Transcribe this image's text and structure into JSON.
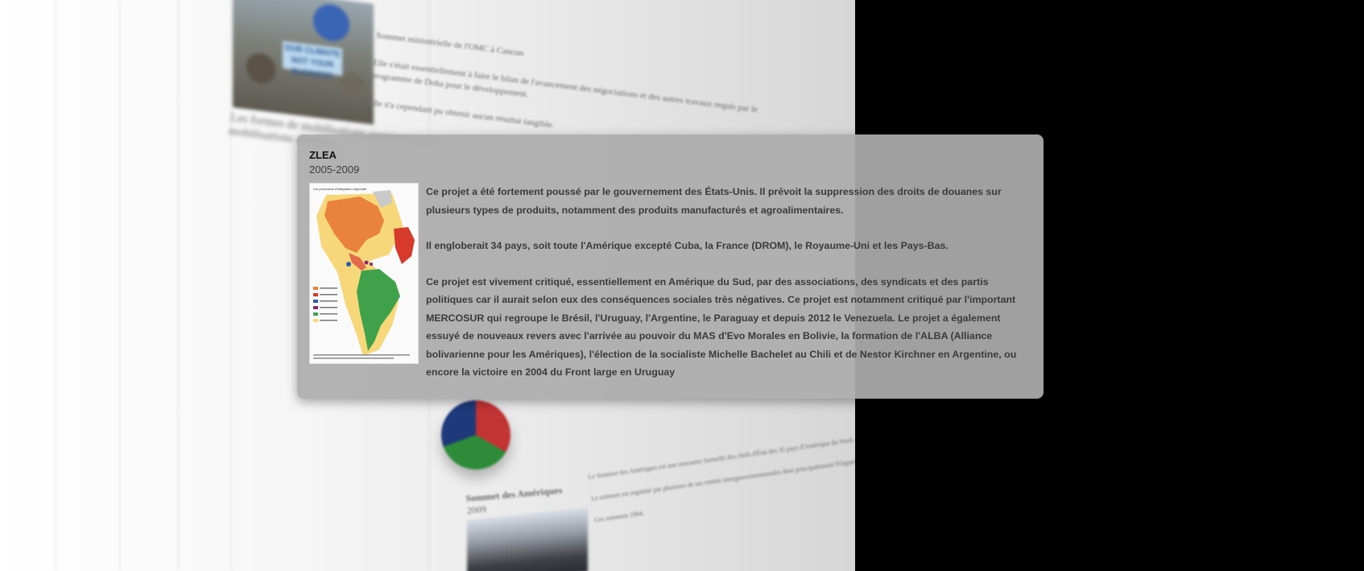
{
  "backdrop": {
    "photo_sign": [
      "OUR CLIMATE",
      "NOT YOUR BUSINESS"
    ],
    "card_top_lines": [
      "Sommet ministérielle de l'OMC à Cancun",
      "Elle s'était essentiellement à faire le bilan de l'avancement des négociations et des autres travaux requis par le",
      "programme de Doha pour le développement.",
      "Elle n'a cependant pu obtenir aucun résultat tangible."
    ],
    "mobilisation_line": "Les formes de mobilisations prennent les le",
    "mobilisation_line_2": "mobilisations diverses",
    "sommet_title": "Sommet des Amériques",
    "sommet_year": "2009",
    "sommet_lines": [
      "Le Sommet des Amériques est une rencontre formelle des chefs d'État des 35 pays d'Amérique du Nord, Amérique centrale et d'Amérique du Sud.",
      "Le sommet est organisé par plusieurs de ses entités intergouvernementales dont principalement l'Organisation des États américains",
      "Ces sommets 1994."
    ]
  },
  "popup": {
    "title": "ZLEA",
    "dates": "2005-2009",
    "map_caption": "Les processus d'intégration régionale",
    "paragraphs": [
      "Ce projet a été fortement poussé par le gouvernement des États-Unis. Il prévoit la suppression des droits de douanes sur plusieurs types de produits, notamment des produits manufacturés et agroalimentaires.",
      "Il engloberait 34 pays, soit toute l'Amérique excepté Cuba, la France (DROM), le Royaume-Uni et les Pays-Bas.",
      "Ce projet est vivement critiqué, essentiellement en Amérique du Sud, par des associations, des syndicats et des partis politiques car il aurait selon eux des conséquences sociales très négatives. Ce projet est notamment critiqué par l'important MERCOSUR qui regroupe le Brésil, l'Uruguay, l'Argentine, le Paraguay et depuis 2012 le Venezuela. Le projet a également essuyé de nouveaux revers avec l'arrivée au pouvoir du MAS d'Evo Morales en Bolivie, la formation de l'ALBA (Alliance bolivarienne pour les Amériques), l'élection de la socialiste Michelle Bachelet au Chili et de Nestor Kirchner en Argentine, ou encore la victoire en 2004 du Front large en Uruguay"
    ]
  },
  "colors": {
    "popup_bg": "#acacac",
    "map_north_america": "#e8823c",
    "map_south_america": "#3fa24a",
    "map_area": "#f6d77a",
    "map_highlight": "#d63a2a"
  }
}
